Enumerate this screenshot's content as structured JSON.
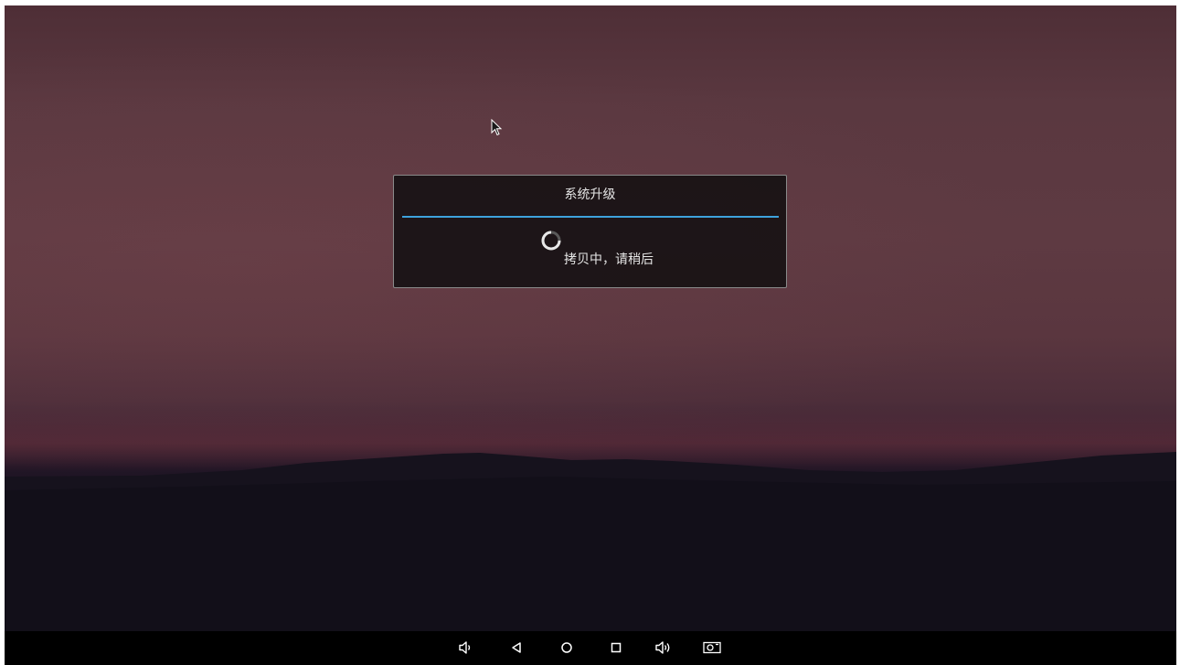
{
  "dialog": {
    "title": "系统升级",
    "message": "拷贝中，请稍后"
  },
  "colors": {
    "accent": "#3ea2dc",
    "dialog_bg": "#181214",
    "navbar_bg": "#000000",
    "text": "#e6e6e6"
  },
  "navbar": {
    "buttons": [
      {
        "icon": "volume-down-icon"
      },
      {
        "icon": "back-icon"
      },
      {
        "icon": "home-icon"
      },
      {
        "icon": "recents-icon"
      },
      {
        "icon": "volume-up-icon"
      },
      {
        "icon": "screenshot-icon"
      }
    ]
  }
}
